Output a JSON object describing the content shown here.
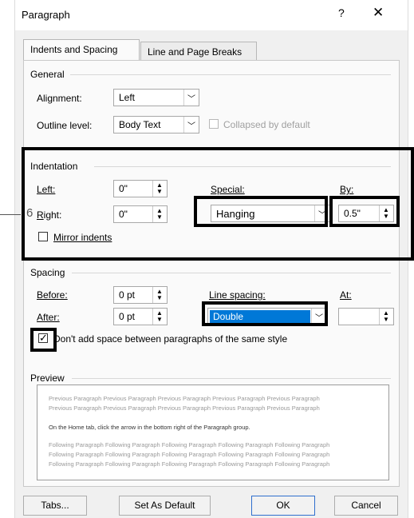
{
  "dialog": {
    "title": "Paragraph",
    "help": "?",
    "close": "✕",
    "tabs": [
      {
        "label": "Indents and Spacing",
        "active": true
      },
      {
        "label": "Line and Page Breaks",
        "active": false
      }
    ]
  },
  "general": {
    "title": "General",
    "alignment_label": "Alignment:",
    "alignment_value": "Left",
    "outline_label": "Outline level:",
    "outline_value": "Body Text",
    "collapsed_label": "Collapsed by default"
  },
  "indentation": {
    "title": "Indentation",
    "left_label": "Left:",
    "left_value": "0\"",
    "right_label": "Right:",
    "right_value": "0\"",
    "special_label": "Special:",
    "special_value": "Hanging",
    "by_label": "By:",
    "by_value": "0.5\"",
    "mirror_label": "Mirror indents"
  },
  "spacing": {
    "title": "Spacing",
    "before_label": "Before:",
    "before_value": "0 pt",
    "after_label": "After:",
    "after_value": "0 pt",
    "line_spacing_label": "Line spacing:",
    "line_spacing_value": "Double",
    "at_label": "At:",
    "dont_add_label": "Don't add space between paragraphs of the same style"
  },
  "preview": {
    "title": "Preview",
    "previous_1": "Previous Paragraph Previous Paragraph Previous Paragraph Previous Paragraph Previous Paragraph",
    "previous_2": "Previous Paragraph Previous Paragraph Previous Paragraph Previous Paragraph Previous Paragraph",
    "current": "On the Home tab, click the arrow in the bottom right of the Paragraph group.",
    "following_1": "Following Paragraph Following Paragraph Following Paragraph Following Paragraph Following Paragraph",
    "following_2": "Following Paragraph Following Paragraph Following Paragraph Following Paragraph Following Paragraph",
    "following_3": "Following Paragraph Following Paragraph Following Paragraph Following Paragraph Following Paragraph"
  },
  "buttons": {
    "tabs": "Tabs...",
    "set_default": "Set As Default",
    "ok": "OK",
    "cancel": "Cancel"
  },
  "annotation": {
    "step_number": "6"
  },
  "colors": {
    "selection": "#0078d7",
    "focus": "#2f6fce"
  }
}
